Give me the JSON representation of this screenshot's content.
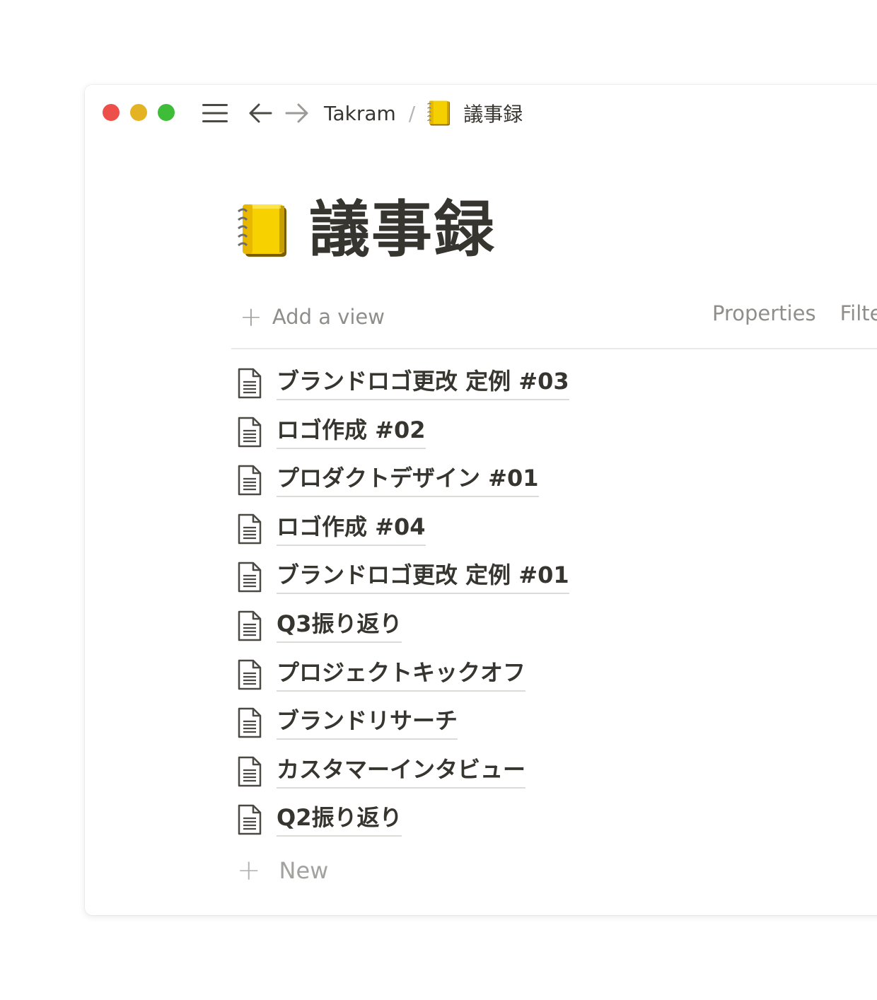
{
  "titlebar": {
    "workspace": "Takram",
    "separator": "/",
    "page": "議事録"
  },
  "page": {
    "title": "議事録",
    "icon": "notebook-icon"
  },
  "viewbar": {
    "add_view": "Add a view",
    "properties": "Properties",
    "filter": "Filte"
  },
  "items": [
    {
      "title": "ブランドロゴ更改 定例 #03"
    },
    {
      "title": "ロゴ作成 #02"
    },
    {
      "title": "プロダクトデザイン #01"
    },
    {
      "title": "ロゴ作成 #04"
    },
    {
      "title": "ブランドロゴ更改 定例 #01"
    },
    {
      "title": "Q3振り返り"
    },
    {
      "title": "プロジェクトキックオフ"
    },
    {
      "title": "ブランドリサーチ"
    },
    {
      "title": "カスタマーインタビュー"
    },
    {
      "title": "Q2振り返り"
    }
  ],
  "new_label": "New",
  "colors": {
    "close": "#ed4f4a",
    "minimize": "#e3b324",
    "maximize": "#3fbd39",
    "text": "#37352f",
    "muted": "#8f8e8b"
  }
}
